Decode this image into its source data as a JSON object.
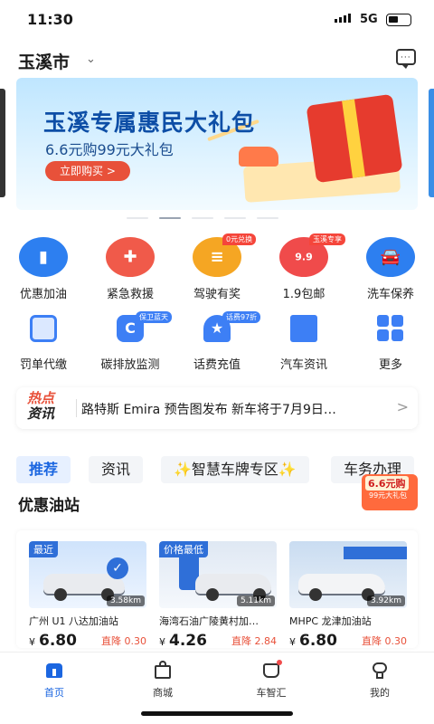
{
  "status": {
    "time": "11:30",
    "network": "5G"
  },
  "header": {
    "city": "玉溪市"
  },
  "banner": {
    "title": "玉溪专属惠民大礼包",
    "subtitle": "6.6元购99元大礼包",
    "button": "立即购买 >"
  },
  "services_row1": [
    {
      "label": "优惠加油",
      "icon": "oil-can-icon",
      "color": "#2d7ff0"
    },
    {
      "label": "紧急救援",
      "icon": "rescue-icon",
      "color": "#f05a4a"
    },
    {
      "label": "驾驶有奖",
      "icon": "coin-stack-icon",
      "color": "#f5a623",
      "tag": "0元兑换"
    },
    {
      "label": "1.9包邮",
      "icon": "gift-bag-icon",
      "color": "#f04b4b",
      "tag": "玉溪专享"
    },
    {
      "label": "洗车保养",
      "icon": "car-wash-icon",
      "color": "#2d7ff0"
    }
  ],
  "services_row2": [
    {
      "label": "罚单代缴",
      "icon": "ticket-icon",
      "color": "#3d7ff5"
    },
    {
      "label": "碳排放监测",
      "icon": "carbon-icon",
      "color": "#3d7ff5",
      "tag": "保卫蓝天"
    },
    {
      "label": "话费充值",
      "icon": "phone-bill-icon",
      "color": "#3d7ff5",
      "tag": "话费97折"
    },
    {
      "label": "汽车资讯",
      "icon": "news-icon",
      "color": "#3d7ff5"
    },
    {
      "label": "更多",
      "icon": "grid-more-icon",
      "color": "#3d7ff5"
    }
  ],
  "news": {
    "hot1": "热点",
    "hot2": "资讯",
    "headline": "路特斯 Emira 预告图发布 新车将于7月9日…"
  },
  "tabs": [
    "推荐",
    "资讯",
    "✨智慧车牌专区✨",
    "车务办理"
  ],
  "promo": {
    "line1": "6.6元购",
    "line2": "99元大礼包"
  },
  "section_title": "优惠油站",
  "stations": [
    {
      "badge": "最近",
      "distance": "3.58km",
      "name": "广州 U1 八达加油站",
      "currency": "¥",
      "price": "6.80",
      "drop": "直降 0.30"
    },
    {
      "badge": "价格最低",
      "distance": "5.11km",
      "name": "海湾石油广陵黄村加…",
      "currency": "¥",
      "price": "4.26",
      "drop": "直降 2.84"
    },
    {
      "badge": "",
      "distance": "3.92km",
      "name": "MHPC 龙津加油站",
      "currency": "¥",
      "price": "6.80",
      "drop": "直降 0.30"
    }
  ],
  "nav": [
    {
      "label": "首页",
      "icon": "home-icon",
      "active": true
    },
    {
      "label": "商城",
      "icon": "shop-bag-icon",
      "active": false
    },
    {
      "label": "车智汇",
      "icon": "car-hub-icon",
      "active": false
    },
    {
      "label": "我的",
      "icon": "profile-icon",
      "active": false
    }
  ]
}
